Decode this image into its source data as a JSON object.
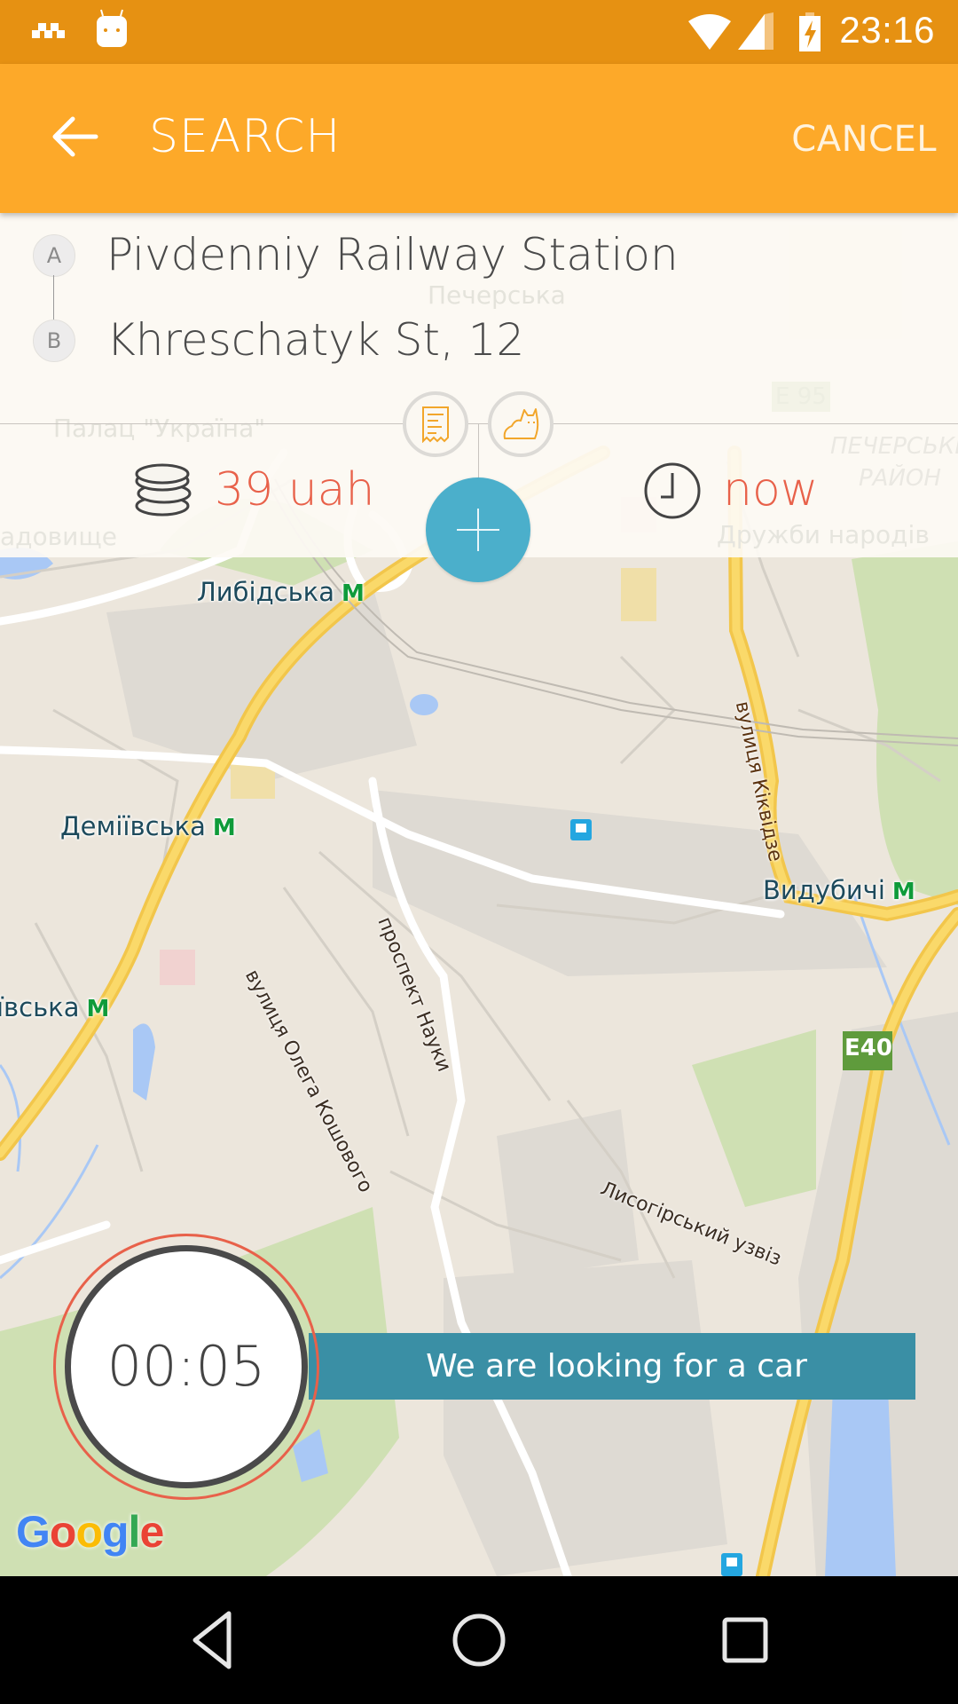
{
  "status_bar": {
    "time": "23:16",
    "left_icons": [
      "taxi-checker-icon",
      "android-icon"
    ],
    "right_icons": [
      "wifi-icon",
      "cell-signal-icon",
      "battery-charging-icon"
    ]
  },
  "app_bar": {
    "title": "SEARCH",
    "back_icon": "arrow-left-icon",
    "cancel_label": "CANCEL"
  },
  "route": {
    "origin": {
      "marker": "A",
      "address": "Pivdenniy Railway Station"
    },
    "destination": {
      "marker": "B",
      "address": "Khreschatyk St, 12"
    }
  },
  "options": {
    "buttons": [
      {
        "name": "receipt-icon"
      },
      {
        "name": "pet-cat-icon"
      }
    ],
    "price": {
      "icon": "coins-icon",
      "value": "39 uah"
    },
    "time": {
      "icon": "clock-icon",
      "value": "now"
    },
    "add_button_icon": "plus-icon"
  },
  "map": {
    "faded_labels": [
      "Печерська",
      "Палац \"Україна\"",
      "E 95",
      "ПЕЧЕРСЬКИЙ",
      "РАЙОН",
      "Дружби народів",
      "адовище"
    ],
    "metro_labels": [
      "Либідська",
      "Деміївська",
      "Видубичі",
      "ївська"
    ],
    "street_labels": [
      "вулиця Кіквідзе",
      "проспект Науки",
      "вулиця Олега Кошового",
      "Лисогірський узвіз"
    ],
    "highway_shield": "E40",
    "metro_symbol": "M",
    "attribution": "Google"
  },
  "search_status": {
    "timer": "00:05",
    "message": "We are looking for a car"
  },
  "nav_bar": {
    "buttons": [
      "back-triangle-icon",
      "home-circle-icon",
      "recents-square-icon"
    ]
  },
  "colors": {
    "status_bar": "#E69112",
    "app_bar": "#FDA929",
    "accent_red": "#E8614A",
    "fab_blue": "#4BAFCB",
    "banner_teal": "#3A8FA5",
    "metro_green": "#0F9B3A"
  }
}
